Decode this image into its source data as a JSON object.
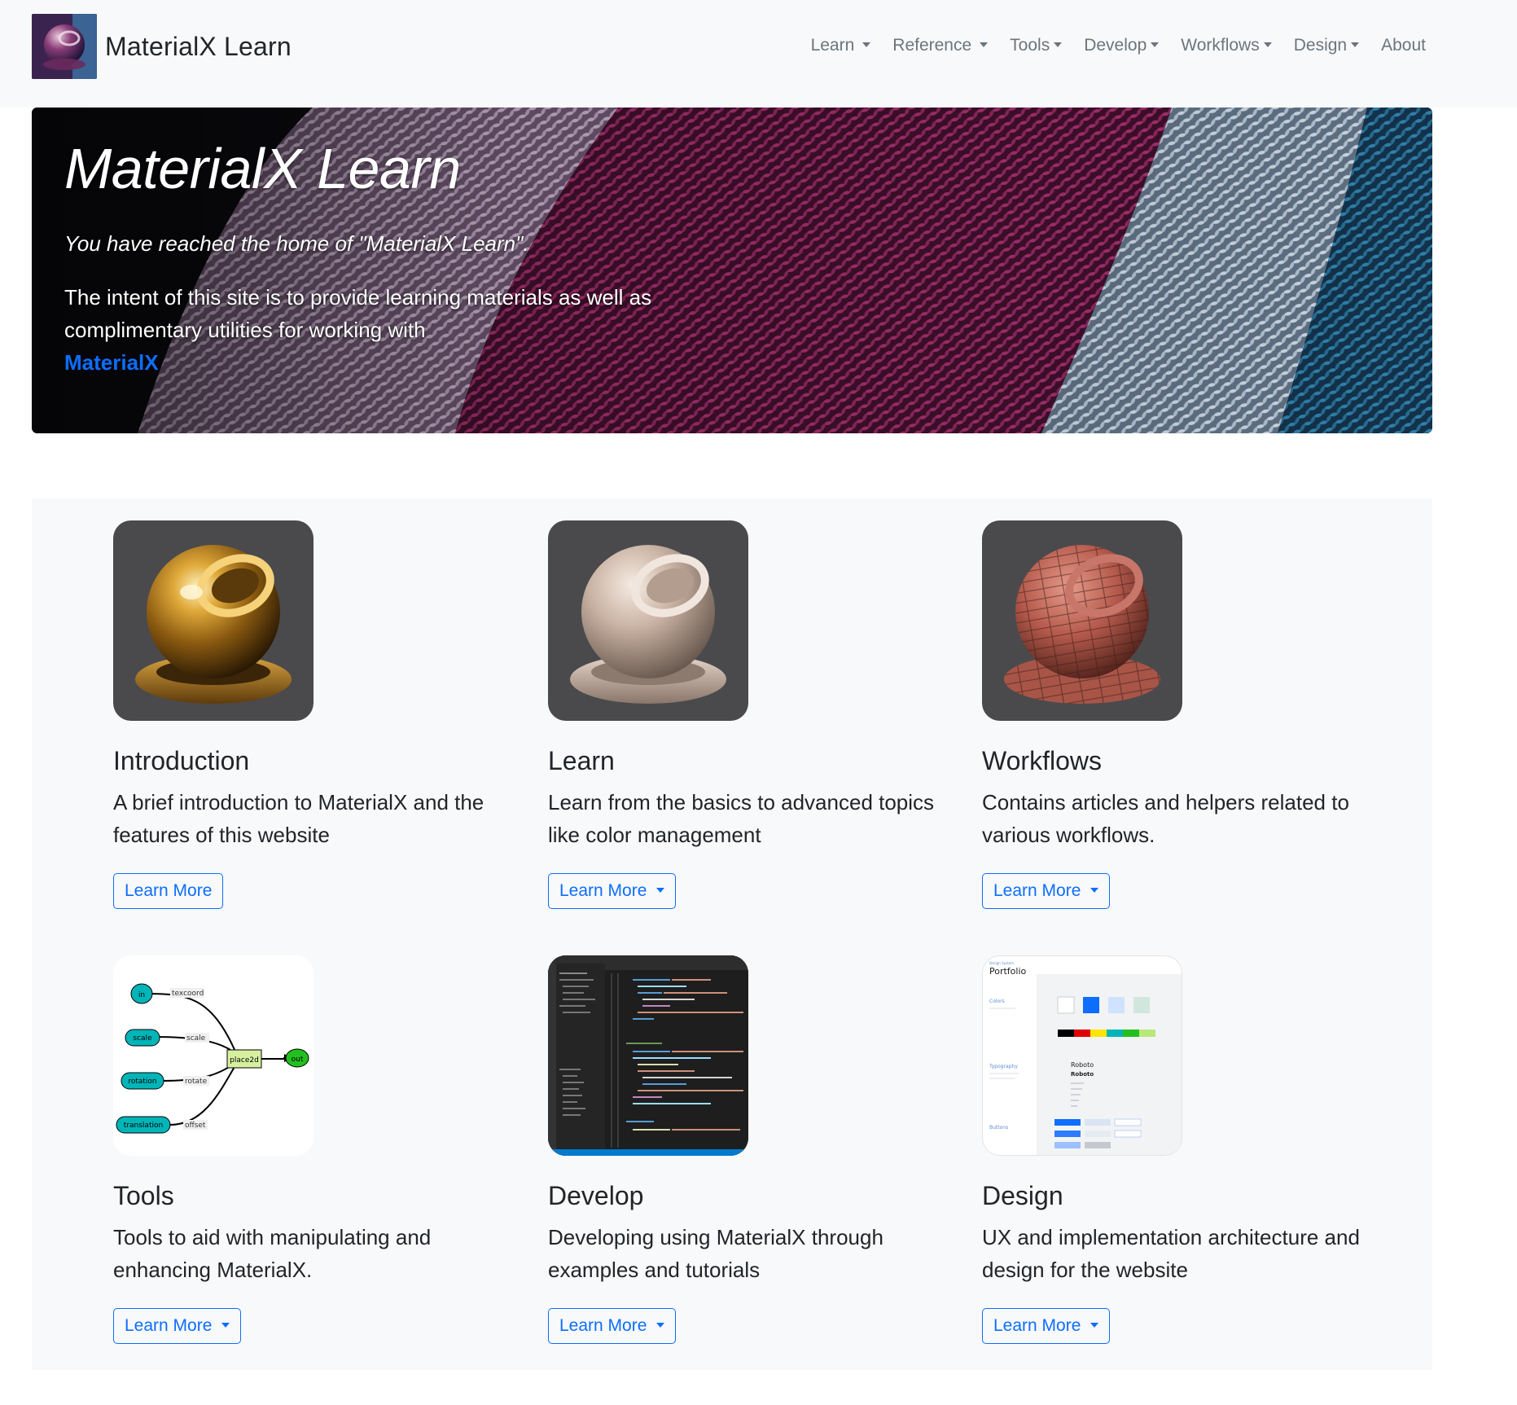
{
  "brand": {
    "title": "MaterialX Learn",
    "logo_icon": "materialx-sphere-logo-icon"
  },
  "nav": {
    "items": [
      {
        "label": "Learn",
        "dropdown": true
      },
      {
        "label": "Reference",
        "dropdown": true
      },
      {
        "label": "Tools",
        "dropdown": true
      },
      {
        "label": "Develop",
        "dropdown": true
      },
      {
        "label": "Workflows",
        "dropdown": true
      },
      {
        "label": "Design",
        "dropdown": true
      },
      {
        "label": "About",
        "dropdown": false
      }
    ]
  },
  "hero": {
    "title": "MaterialX Learn",
    "subtitle": "You have reached the home of \"MaterialX Learn\".",
    "body": "The intent of this site is to provide learning materials as well as complimentary utilities for working with",
    "link": "MaterialX"
  },
  "cards": [
    {
      "title": "Introduction",
      "text": "A brief introduction to MaterialX and the features of this website",
      "button": "Learn More",
      "dropdown": false,
      "image": "gold-sphere-image"
    },
    {
      "title": "Learn",
      "text": "Learn from the basics to advanced topics like color management",
      "button": "Learn More",
      "dropdown": true,
      "image": "silver-sphere-image"
    },
    {
      "title": "Workflows",
      "text": "Contains articles and helpers related to various workflows.",
      "button": "Learn More",
      "dropdown": true,
      "image": "brick-sphere-image"
    },
    {
      "title": "Tools",
      "text": "Tools to aid with manipulating and enhancing MaterialX.",
      "button": "Learn More",
      "dropdown": true,
      "image": "node-graph-image"
    },
    {
      "title": "Develop",
      "text": "Developing using MaterialX through examples and tutorials",
      "button": "Learn More",
      "dropdown": true,
      "image": "code-editor-image"
    },
    {
      "title": "Design",
      "text": "UX and implementation architecture and design for the website",
      "button": "Learn More",
      "dropdown": true,
      "image": "design-portfolio-image"
    }
  ],
  "node_graph": {
    "nodes": [
      "in",
      "scale",
      "rotation",
      "translation",
      "place2d",
      "out"
    ],
    "ports": [
      "texcoord",
      "scale",
      "rotate",
      "offset"
    ]
  },
  "portfolio": {
    "caption": "Design System",
    "title": "Portfolio",
    "sections": [
      "Colors",
      "Typography",
      "Buttons"
    ],
    "font_samples": [
      "Roboto",
      "Roboto"
    ]
  },
  "colors": {
    "primary": "#0d6efd",
    "nav_text": "#6c757d",
    "navbar_bg": "#f8f9fa",
    "section_bg": "#f8f9fa",
    "node_teal": "#00b5b8",
    "node_green": "#22c01e",
    "node_place2d": "#d7f0a0"
  }
}
